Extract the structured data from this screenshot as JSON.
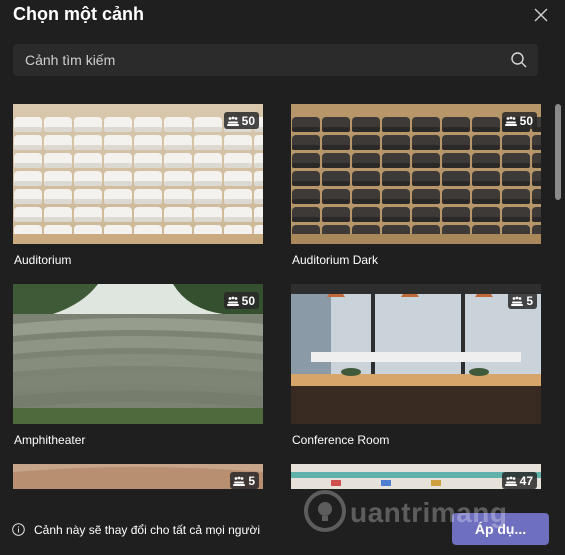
{
  "dialog": {
    "title": "Chọn một cảnh",
    "close_icon": "close-icon"
  },
  "search": {
    "placeholder": "Cảnh tìm kiếm",
    "icon": "search-icon"
  },
  "scenes": [
    {
      "name": "Auditorium",
      "capacity": "50",
      "icon": "people-icon"
    },
    {
      "name": "Auditorium Dark",
      "capacity": "50",
      "icon": "people-icon"
    },
    {
      "name": "Amphitheater",
      "capacity": "50",
      "icon": "people-icon"
    },
    {
      "name": "Conference Room",
      "capacity": "5",
      "icon": "people-icon"
    },
    {
      "name": "",
      "capacity": "5",
      "icon": "people-icon"
    },
    {
      "name": "",
      "capacity": "47",
      "icon": "people-icon"
    }
  ],
  "footer": {
    "info_text": "Cảnh này sẽ thay đổi cho tất cả mọi người",
    "apply_label": "Áp dụ...",
    "info_icon": "info-icon"
  },
  "watermark": {
    "text": "uantrimang"
  },
  "colors": {
    "background": "#1f1f1f",
    "search_bg": "#2b2b2b",
    "accent": "#6f6fbf"
  }
}
